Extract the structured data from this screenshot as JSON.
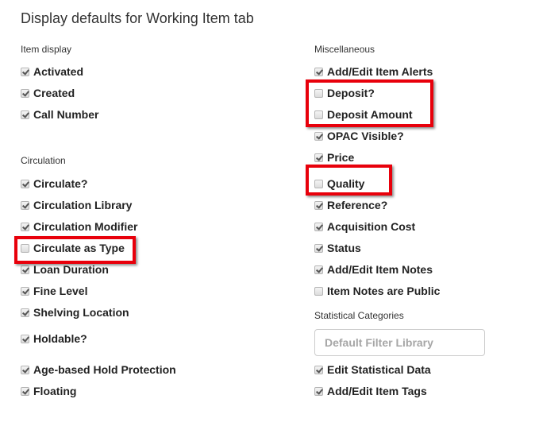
{
  "title": "Display defaults for Working Item tab",
  "item_display": {
    "label": "Item display",
    "items": [
      {
        "label": "Activated",
        "checked": true
      },
      {
        "label": "Created",
        "checked": true
      },
      {
        "label": "Call Number",
        "checked": true
      }
    ]
  },
  "circulation": {
    "label": "Circulation",
    "items": [
      {
        "label": "Circulate?",
        "checked": true
      },
      {
        "label": "Circulation Library",
        "checked": true
      },
      {
        "label": "Circulation Modifier",
        "checked": true
      },
      {
        "label": "Circulate as Type",
        "checked": false
      },
      {
        "label": "Loan Duration",
        "checked": true
      },
      {
        "label": "Fine Level",
        "checked": true
      },
      {
        "label": "Shelving Location",
        "checked": true
      },
      {
        "label": "Holdable?",
        "checked": true
      },
      {
        "label": "Age-based Hold Protection",
        "checked": true
      },
      {
        "label": "Floating",
        "checked": true
      }
    ]
  },
  "miscellaneous": {
    "label": "Miscellaneous",
    "items": [
      {
        "label": "Add/Edit Item Alerts",
        "checked": true
      },
      {
        "label": "Deposit?",
        "checked": false
      },
      {
        "label": "Deposit Amount",
        "checked": false
      },
      {
        "label": "OPAC Visible?",
        "checked": true
      },
      {
        "label": "Price",
        "checked": true
      },
      {
        "label": "Quality",
        "checked": false
      },
      {
        "label": "Reference?",
        "checked": true
      },
      {
        "label": "Acquisition Cost",
        "checked": true
      },
      {
        "label": "Status",
        "checked": true
      },
      {
        "label": "Add/Edit Item Notes",
        "checked": true
      },
      {
        "label": "Item Notes are Public",
        "checked": false
      }
    ]
  },
  "statistical_categories": {
    "label": "Statistical Categories",
    "filter_placeholder": "Default Filter Library",
    "items": [
      {
        "label": "Edit Statistical Data",
        "checked": true
      },
      {
        "label": "Add/Edit Item Tags",
        "checked": true
      }
    ]
  },
  "highlight_color": "#e8000b"
}
